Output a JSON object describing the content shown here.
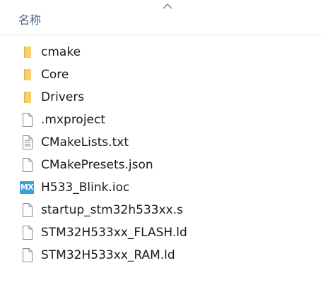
{
  "header": {
    "name_column": "名称"
  },
  "files": [
    {
      "label": "cmake",
      "icon": "folder-icon",
      "kind": "folder"
    },
    {
      "label": "Core",
      "icon": "folder-icon",
      "kind": "folder"
    },
    {
      "label": "Drivers",
      "icon": "folder-icon",
      "kind": "folder"
    },
    {
      "label": ".mxproject",
      "icon": "file-icon",
      "kind": "file"
    },
    {
      "label": "CMakeLists.txt",
      "icon": "text-file-icon",
      "kind": "text"
    },
    {
      "label": "CMakePresets.json",
      "icon": "file-icon",
      "kind": "file"
    },
    {
      "label": "H533_Blink.ioc",
      "icon": "mx-icon",
      "kind": "mx",
      "badge": "MX"
    },
    {
      "label": "startup_stm32h533xx.s",
      "icon": "file-icon",
      "kind": "file"
    },
    {
      "label": "STM32H533xx_FLASH.ld",
      "icon": "file-icon",
      "kind": "file"
    },
    {
      "label": "STM32H533xx_RAM.ld",
      "icon": "file-icon",
      "kind": "file"
    }
  ],
  "colors": {
    "folder": "#f7cf6b",
    "folder_dark": "#e8b84a",
    "header_text": "#4c607a",
    "mx_badge": "#3aa0d8"
  }
}
